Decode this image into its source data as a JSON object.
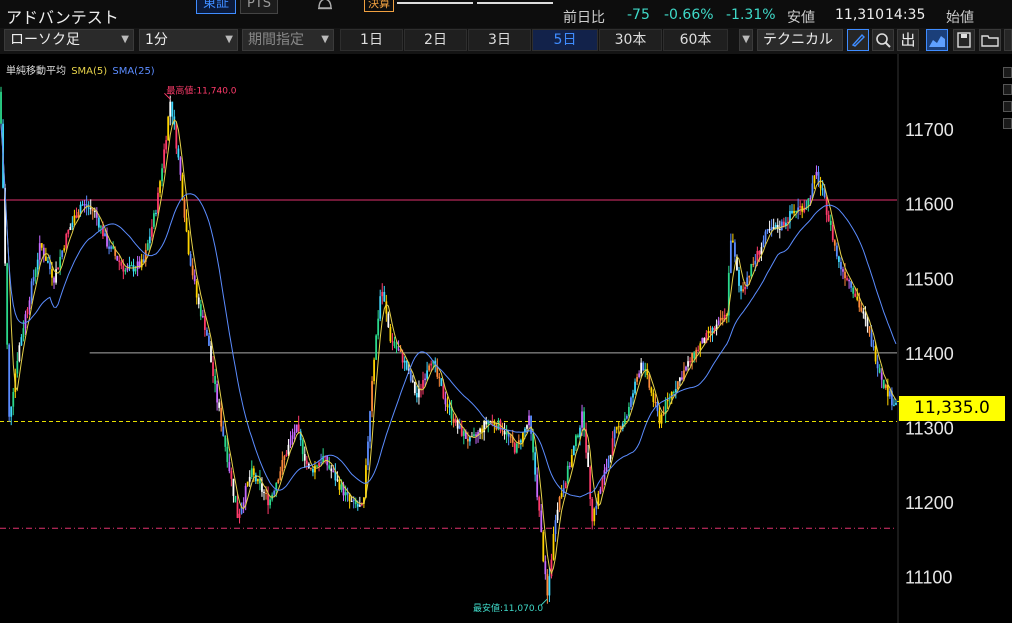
{
  "header": {
    "stock_name": "アドバンテスト",
    "exchange_tabs": [
      "東証",
      "PTS"
    ],
    "badge": "決算",
    "change_label": "前日比",
    "change": "-75",
    "change_pct": "-0.66%",
    "change_pct2": "-1.31%",
    "low_label": "安値",
    "low_value": "11,310",
    "time": "14:35",
    "open_label": "始値"
  },
  "toolbar": {
    "chart_type": "ローソク足",
    "interval": "1分",
    "period_placeholder": "期間指定",
    "ranges": [
      "1日",
      "2日",
      "3日",
      "5日",
      "30本",
      "60本"
    ],
    "active_range": "5日",
    "technical": "テクニカル",
    "output_label": "出",
    "icons": [
      "pen-icon",
      "zoom-icon",
      "export-icon",
      "area-chart-icon",
      "save-icon",
      "folder-icon",
      "more-icon"
    ]
  },
  "legend": {
    "label": "単純移動平均",
    "sma5": "SMA(5)",
    "sma25": "SMA(25)",
    "sma5_color": "#e6d24a",
    "sma25_color": "#5b8cff"
  },
  "chart_data": {
    "type": "line",
    "y_ticks": [
      11700,
      11600,
      11500,
      11400,
      11300,
      11200,
      11100
    ],
    "y_tick_labels": [
      "11700",
      "11600",
      "11500",
      "11400",
      "11300",
      "11200",
      "11100"
    ],
    "ylim": [
      11050,
      11790
    ],
    "high_label": "最高値:11,740.0",
    "high_value": 11740,
    "high_at": 0.19,
    "low_label": "最安値:11,070.0",
    "low_value": 11070,
    "low_at": 0.61,
    "current_price": 11335,
    "current_price_label": "11,335.0",
    "hlines": [
      {
        "value": 11605,
        "color": "#e0326e",
        "style": "solid"
      },
      {
        "value": 11400,
        "color": "#aaaaaa",
        "style": "solid",
        "from": 0.1
      },
      {
        "value": 11308,
        "color": "#e8e000",
        "style": "dashed"
      },
      {
        "value": 11165,
        "color": "#e0326e",
        "style": "dashdot"
      }
    ],
    "anchors": [
      [
        0.0,
        11750
      ],
      [
        0.004,
        11600
      ],
      [
        0.01,
        11310
      ],
      [
        0.02,
        11400
      ],
      [
        0.03,
        11460
      ],
      [
        0.045,
        11545
      ],
      [
        0.06,
        11500
      ],
      [
        0.075,
        11560
      ],
      [
        0.09,
        11600
      ],
      [
        0.105,
        11590
      ],
      [
        0.12,
        11545
      ],
      [
        0.14,
        11510
      ],
      [
        0.16,
        11520
      ],
      [
        0.175,
        11600
      ],
      [
        0.185,
        11690
      ],
      [
        0.19,
        11740
      ],
      [
        0.2,
        11650
      ],
      [
        0.21,
        11540
      ],
      [
        0.22,
        11470
      ],
      [
        0.23,
        11430
      ],
      [
        0.24,
        11350
      ],
      [
        0.255,
        11250
      ],
      [
        0.265,
        11180
      ],
      [
        0.28,
        11240
      ],
      [
        0.3,
        11200
      ],
      [
        0.32,
        11270
      ],
      [
        0.33,
        11300
      ],
      [
        0.345,
        11240
      ],
      [
        0.36,
        11260
      ],
      [
        0.375,
        11230
      ],
      [
        0.39,
        11200
      ],
      [
        0.405,
        11190
      ],
      [
        0.415,
        11370
      ],
      [
        0.425,
        11490
      ],
      [
        0.435,
        11420
      ],
      [
        0.45,
        11390
      ],
      [
        0.465,
        11340
      ],
      [
        0.48,
        11395
      ],
      [
        0.495,
        11340
      ],
      [
        0.51,
        11300
      ],
      [
        0.525,
        11280
      ],
      [
        0.545,
        11310
      ],
      [
        0.56,
        11300
      ],
      [
        0.575,
        11270
      ],
      [
        0.59,
        11310
      ],
      [
        0.6,
        11200
      ],
      [
        0.61,
        11070
      ],
      [
        0.62,
        11190
      ],
      [
        0.635,
        11250
      ],
      [
        0.65,
        11320
      ],
      [
        0.66,
        11180
      ],
      [
        0.67,
        11220
      ],
      [
        0.685,
        11290
      ],
      [
        0.7,
        11320
      ],
      [
        0.715,
        11390
      ],
      [
        0.725,
        11350
      ],
      [
        0.735,
        11310
      ],
      [
        0.75,
        11350
      ],
      [
        0.765,
        11380
      ],
      [
        0.78,
        11410
      ],
      [
        0.795,
        11430
      ],
      [
        0.81,
        11450
      ],
      [
        0.815,
        11560
      ],
      [
        0.825,
        11480
      ],
      [
        0.84,
        11520
      ],
      [
        0.855,
        11560
      ],
      [
        0.87,
        11570
      ],
      [
        0.885,
        11590
      ],
      [
        0.9,
        11600
      ],
      [
        0.91,
        11640
      ],
      [
        0.92,
        11600
      ],
      [
        0.935,
        11520
      ],
      [
        0.95,
        11490
      ],
      [
        0.965,
        11440
      ],
      [
        0.975,
        11400
      ],
      [
        0.985,
        11360
      ],
      [
        0.995,
        11335
      ],
      [
        1.0,
        11335
      ]
    ]
  }
}
